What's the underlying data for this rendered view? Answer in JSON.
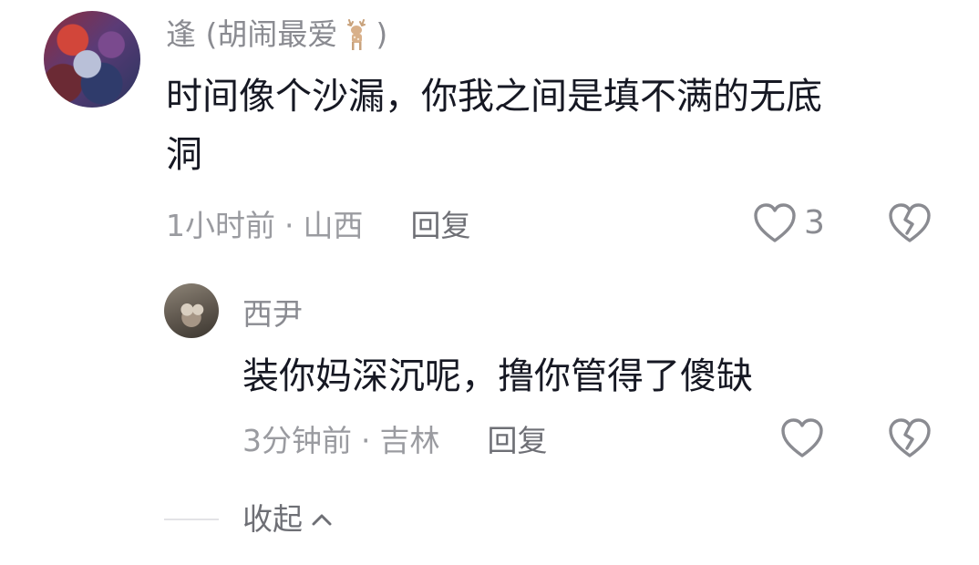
{
  "comment": {
    "username": "逢 (胡闹最爱",
    "username_close": ")",
    "text_line1": "时间像个沙漏，你我之间是填不满的无底",
    "text_line2": "洞",
    "time": "1小时前",
    "separator": "·",
    "location": "山西",
    "reply_label": "回复",
    "like_count": "3"
  },
  "reply": {
    "username": "西尹",
    "text": "装你妈深沉呢，撸你管得了傻缺",
    "time": "3分钟前",
    "separator": "·",
    "location": "吉林",
    "reply_label": "回复"
  },
  "collapse": {
    "label": "收起"
  },
  "icons": {
    "like": "heart-outline-icon",
    "dislike": "broken-heart-icon",
    "deer": "deer-emoji-icon",
    "collapse": "chevron-up-icon"
  },
  "colors": {
    "text": "#161823",
    "muted": "#8a8b91",
    "icon": "#8a8b91"
  }
}
